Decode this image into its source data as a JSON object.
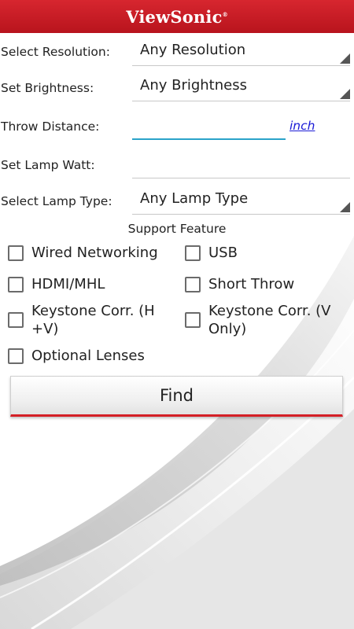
{
  "header": {
    "brand": "ViewSonic",
    "brand_mark": "®"
  },
  "form": {
    "resolution": {
      "label": "Select Resolution:",
      "value": "Any Resolution"
    },
    "brightness": {
      "label": "Set Brightness:",
      "value": "Any Brightness"
    },
    "throw_distance": {
      "label": "Throw Distance:",
      "value": "",
      "unit": "inch"
    },
    "lamp_watt": {
      "label": "Set Lamp Watt:",
      "value": ""
    },
    "lamp_type": {
      "label": "Select Lamp Type:",
      "value": "Any Lamp Type"
    }
  },
  "features": {
    "title": "Support Feature",
    "items": [
      {
        "label": "Wired Networking",
        "checked": false
      },
      {
        "label": "USB",
        "checked": false
      },
      {
        "label": "HDMI/MHL",
        "checked": false
      },
      {
        "label": "Short Throw",
        "checked": false
      },
      {
        "label": "Keystone Corr. (H +V)",
        "checked": false
      },
      {
        "label": "Keystone Corr. (V Only)",
        "checked": false
      },
      {
        "label": "Optional Lenses",
        "checked": false
      }
    ]
  },
  "find_button": {
    "label": "Find"
  },
  "colors": {
    "brand_red": "#c41e26",
    "focus_blue": "#2aa3c9",
    "link_blue": "#1a1ad6"
  }
}
